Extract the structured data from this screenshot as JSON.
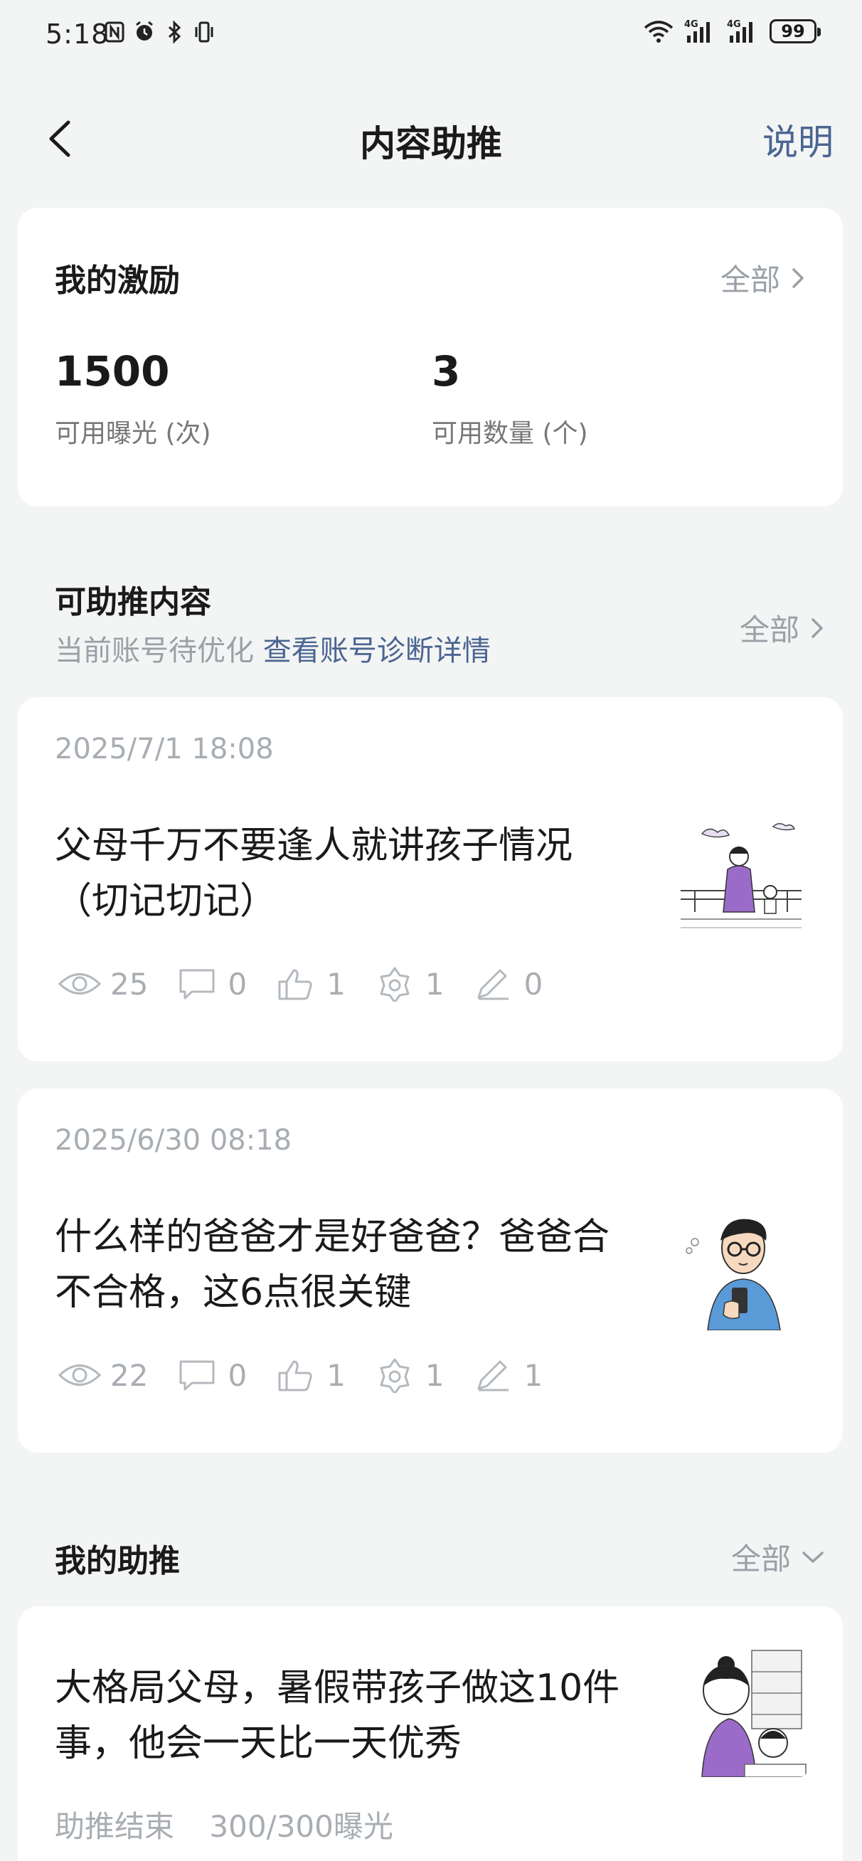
{
  "status_bar": {
    "time": "5:18",
    "battery": "99",
    "icons_left": [
      "nfc-icon",
      "alarm-icon",
      "bluetooth-icon",
      "vibrate-icon"
    ],
    "icons_right": [
      "wifi-icon",
      "4g-signal-icon",
      "4g-signal-icon"
    ]
  },
  "header": {
    "title": "内容助推",
    "help_label": "说明"
  },
  "incentive": {
    "title": "我的激励",
    "all_label": "全部",
    "stats": [
      {
        "value": "1500",
        "label": "可用曝光 (次)"
      },
      {
        "value": "3",
        "label": "可用数量 (个)"
      }
    ]
  },
  "promotable": {
    "title": "可助推内容",
    "subtitle": "当前账号待优化",
    "diagnose_link": "查看账号诊断详情",
    "all_label": "全部",
    "posts": [
      {
        "date": "2025/7/1 18:08",
        "title": "父母千万不要逢人就讲孩子情况（切记切记）",
        "views": "25",
        "comments": "0",
        "likes": "1",
        "favorites": "1",
        "edits": "0"
      },
      {
        "date": "2025/6/30 08:18",
        "title": "什么样的爸爸才是好爸爸？爸爸合不合格，这6点很关键",
        "views": "22",
        "comments": "0",
        "likes": "1",
        "favorites": "1",
        "edits": "1"
      }
    ]
  },
  "my_push": {
    "title": "我的助推",
    "all_label": "全部",
    "item": {
      "title": "大格局父母，暑假带孩子做这10件事，他会一天比一天优秀",
      "status": "助推结束",
      "progress": "300/300曝光"
    }
  },
  "colors": {
    "background": "#f3f4f4",
    "card": "#ffffff",
    "accent_link": "#4a6591",
    "muted_text": "#a8adb2"
  }
}
